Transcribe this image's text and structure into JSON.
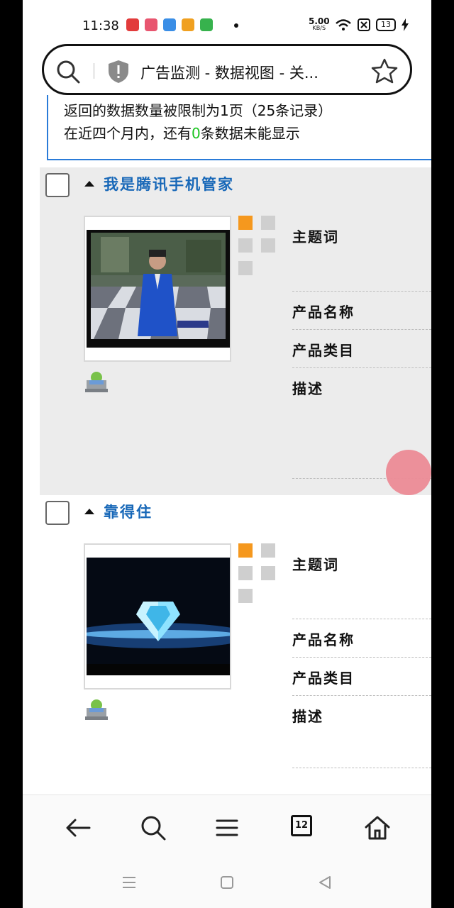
{
  "status_bar": {
    "time": "11:38",
    "net_speed_value": "5.00",
    "net_speed_unit": "KB/S",
    "battery": "13"
  },
  "address_bar": {
    "title": "广告监测 - 数据视图 - 关..."
  },
  "notice": {
    "line1": "返回的数据数量被限制为1页（25条记录）",
    "line2_prefix": "在近四个月内，还有",
    "line2_count": "0",
    "line2_suffix": "条数据未能显示"
  },
  "records": [
    {
      "title": "我是腾讯手机管家",
      "fields": [
        "主题词",
        "产品名称",
        "产品类目",
        "描述"
      ]
    },
    {
      "title": "靠得住",
      "fields": [
        "主题词",
        "产品名称",
        "产品类目",
        "描述"
      ]
    }
  ],
  "toolbar": {
    "tab_count": "12",
    "icons": [
      "back-arrow-icon",
      "search-icon",
      "menu-icon",
      "tabs-icon",
      "home-icon"
    ]
  },
  "colors": {
    "accent_blue": "#1868b8",
    "notice_green": "#19c41f",
    "orange_square": "#f5981e",
    "floating_ball": "#ec8b96"
  }
}
